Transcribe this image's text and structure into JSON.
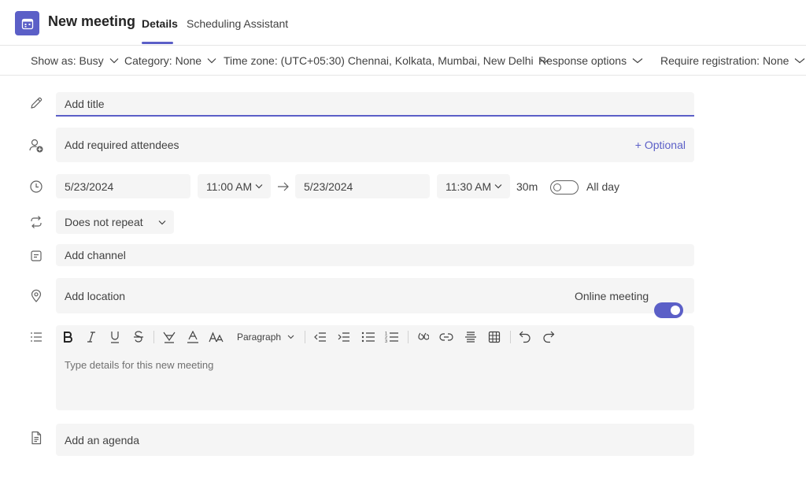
{
  "header": {
    "title": "New meeting",
    "tabs": [
      {
        "label": "Details",
        "active": true
      },
      {
        "label": "Scheduling Assistant",
        "active": false
      }
    ],
    "accent": "#5b5fc7"
  },
  "options": [
    {
      "label": "Show as: Busy"
    },
    {
      "label": "Category: None"
    },
    {
      "label": "Time zone: (UTC+05:30) Chennai, Kolkata, Mumbai, New Delhi"
    },
    {
      "label": "Response options"
    },
    {
      "label": "Require registration: None"
    }
  ],
  "form": {
    "title_placeholder": "Add title",
    "attendees_placeholder": "Add required attendees",
    "optional_label": "+ Optional",
    "start_date": "5/23/2024",
    "start_time": "11:00 AM",
    "end_date": "5/23/2024",
    "end_time": "11:30 AM",
    "duration": "30m",
    "all_day_label": "All day",
    "all_day": false,
    "repeat": "Does not repeat",
    "channel_placeholder": "Add channel",
    "location_placeholder": "Add location",
    "online_meeting_label": "Online meeting",
    "online_meeting": true,
    "details_placeholder": "Type details for this new meeting",
    "agenda_placeholder": "Add an agenda"
  },
  "editor_toolbar": {
    "paragraph_label": "Paragraph",
    "tools": [
      "bold-icon",
      "italic-icon",
      "underline-icon",
      "strikethrough-icon",
      "highlight-icon",
      "font-color-icon",
      "font-size-icon",
      "paragraph-dropdown",
      "decrease-indent-icon",
      "increase-indent-icon",
      "bulleted-list-icon",
      "numbered-list-icon",
      "quote-icon",
      "link-icon",
      "horizontal-rule-icon",
      "table-icon",
      "undo-icon",
      "redo-icon"
    ]
  }
}
